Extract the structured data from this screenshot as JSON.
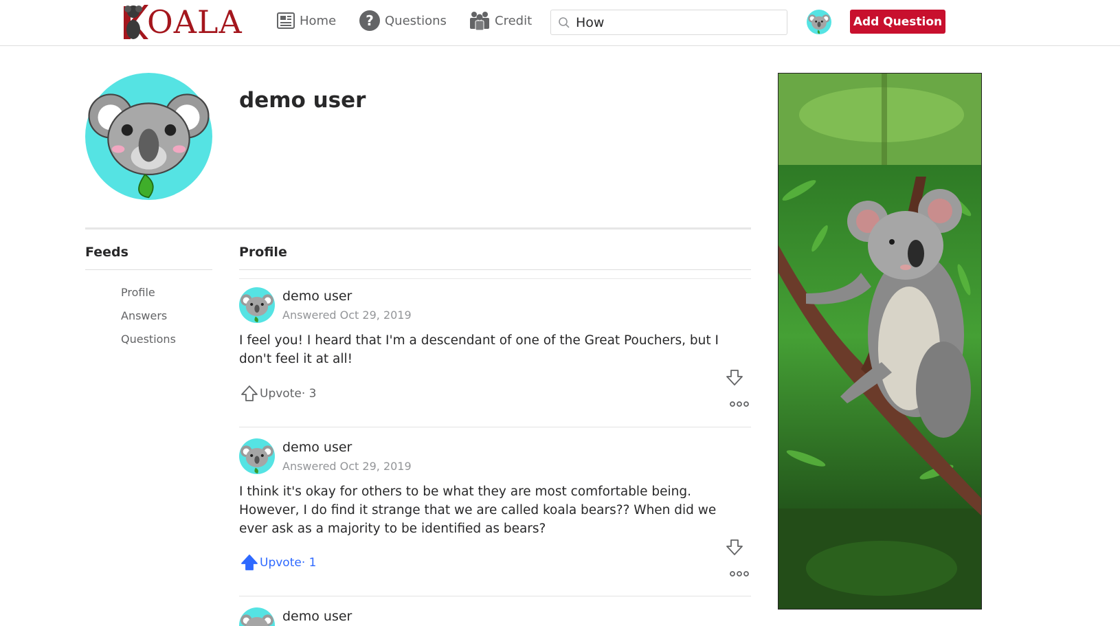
{
  "brand": {
    "name": "OALA",
    "accent": "#a4161d"
  },
  "nav": {
    "home_label": "Home",
    "questions_label": "Questions",
    "credit_label": "Credit",
    "search_value": "How",
    "add_question_label": "Add Question"
  },
  "profile": {
    "name": "demo user"
  },
  "feeds": {
    "title": "Feeds",
    "items": [
      "Profile",
      "Answers",
      "Questions"
    ]
  },
  "content": {
    "title": "Profile",
    "answers": [
      {
        "user": "demo user",
        "date": "Answered Oct 29, 2019",
        "body": "I feel you! I heard that I'm a descendant of one of the Great Pouchers, but I don't feel it at all!",
        "upvote_label": "Upvote· 3",
        "upvoted": false
      },
      {
        "user": "demo user",
        "date": "Answered Oct 29, 2019",
        "body": "I think it's okay for others to be what they are most comfortable being. However, I do find it strange that we are called koala bears?? When did we ever ask as a majority to be identified as bears?",
        "upvote_label": "Upvote· 1",
        "upvoted": true
      },
      {
        "user": "demo user"
      }
    ]
  },
  "colors": {
    "primary_button": "#c8102e",
    "upvote_active": "#2e69ff",
    "avatar_bg": "#55e3e3"
  },
  "icons": {
    "home": "newspaper-icon",
    "questions": "question-circle-icon",
    "credit": "users-group-icon",
    "search": "search-icon",
    "upvote": "arrow-up-icon",
    "downvote": "arrow-down-icon",
    "more": "more-dots-icon"
  }
}
